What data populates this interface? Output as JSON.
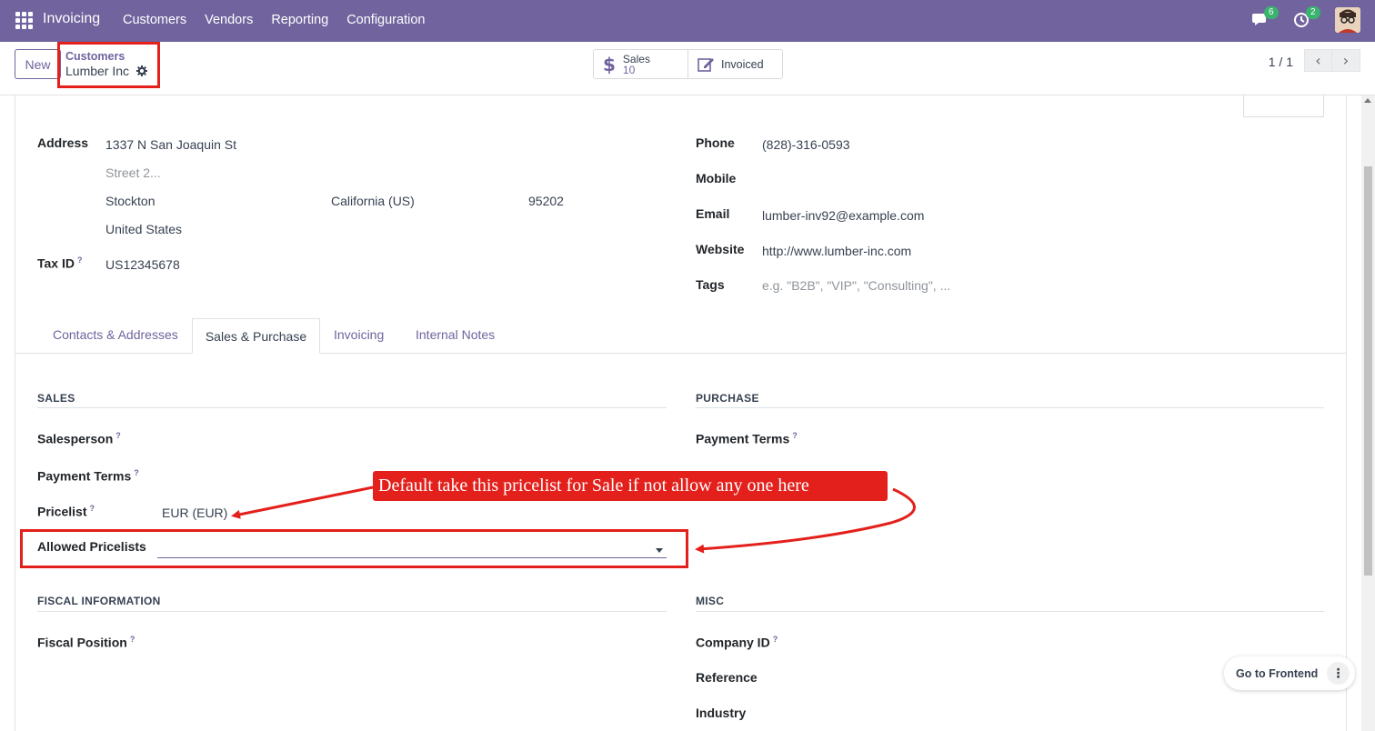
{
  "navbar": {
    "app_name": "Invoicing",
    "menu": [
      "Customers",
      "Vendors",
      "Reporting",
      "Configuration"
    ],
    "messages_count": "6",
    "activities_count": "2"
  },
  "control": {
    "new_label": "New",
    "breadcrumb_parent": "Customers",
    "breadcrumb_current": "Lumber Inc",
    "smart_sales_label": "Sales",
    "smart_sales_count": "10",
    "smart_invoiced_label": "Invoiced",
    "pager": "1 / 1"
  },
  "form": {
    "address_label": "Address",
    "street": "1337 N San Joaquin St",
    "street2_placeholder": "Street 2...",
    "city": "Stockton",
    "state": "California (US)",
    "zip": "95202",
    "country": "United States",
    "tax_id_label": "Tax ID",
    "tax_id": "US12345678",
    "phone_label": "Phone",
    "phone": "(828)-316-0593",
    "mobile_label": "Mobile",
    "email_label": "Email",
    "email": "lumber-inv92@example.com",
    "website_label": "Website",
    "website": "http://www.lumber-inc.com",
    "tags_label": "Tags",
    "tags_placeholder": "e.g. \"B2B\", \"VIP\", \"Consulting\", ..."
  },
  "tabs": [
    "Contacts & Addresses",
    "Sales & Purchase",
    "Invoicing",
    "Internal Notes"
  ],
  "sales": {
    "title": "SALES",
    "salesperson_label": "Salesperson",
    "payment_terms_label": "Payment Terms",
    "pricelist_label": "Pricelist",
    "pricelist_value": "EUR (EUR)",
    "allowed_pricelists_label": "Allowed Pricelists"
  },
  "purchase": {
    "title": "PURCHASE",
    "payment_terms_label": "Payment Terms"
  },
  "fiscal": {
    "title": "FISCAL INFORMATION",
    "fiscal_position_label": "Fiscal Position"
  },
  "misc": {
    "title": "MISC",
    "company_id_label": "Company ID",
    "reference_label": "Reference",
    "industry_label": "Industry"
  },
  "help_mark": "?",
  "annotation": "Default take this pricelist for Sale if not allow any one here",
  "frontend_button": "Go to Frontend",
  "colors": {
    "navbar": "#71639e",
    "accent": "#71639e",
    "annotation_red": "#e3201b",
    "badge_green": "#3ab36e"
  }
}
